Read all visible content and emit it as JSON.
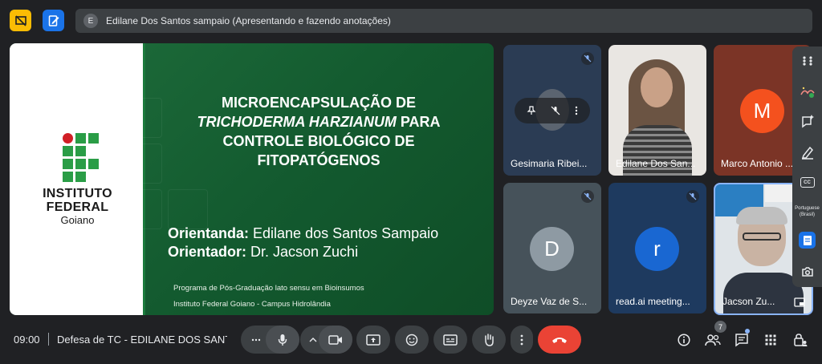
{
  "presenter": {
    "avatar_letter": "E",
    "text": "Edilane Dos Santos sampaio (Apresentando e fazendo anotações)"
  },
  "slide": {
    "institution_line1": "INSTITUTO",
    "institution_line2": "FEDERAL",
    "institution_line3": "Goiano",
    "title_line1": "MICROENCAPSULAÇÃO DE",
    "title_line2_italic": "TRICHODERMA HARZIANUM",
    "title_line2_rest": " PARA",
    "title_line3": "CONTROLE BIOLÓGICO DE",
    "title_line4": "FITOPATÓGENOS",
    "orientanda_label": "Orientanda:",
    "orientanda_name": " Edilane dos Santos Sampaio",
    "orientador_label": "Orientador:",
    "orientador_name": " Dr. Jacson Zuchi",
    "program_line1": "Programa de Pós-Graduação lato sensu em Bioinsumos",
    "program_line2": "Instituto Federal Goiano - Campus Hidrolândia"
  },
  "participants": [
    {
      "name": "Gesimaria Ribei...",
      "muted": true
    },
    {
      "name": "Edilane Dos San...",
      "muted": false
    },
    {
      "name": "Marco Antonio ...",
      "avatar_letter": "M",
      "avatar_color": "#f4511e",
      "muted": false
    },
    {
      "name": "Deyze Vaz de S...",
      "avatar_letter": "D",
      "avatar_color": "#8e9aa3",
      "muted": true
    },
    {
      "name": "read.ai meeting...",
      "avatar_letter": "r",
      "avatar_color": "#1967d2",
      "muted": true
    },
    {
      "name": "Jacson Zu...",
      "muted": false
    }
  ],
  "side_panel": {
    "cc_label": "CC",
    "language_line1": "Portuguese",
    "language_line2": "(Brasil)"
  },
  "bottom": {
    "time": "09:00",
    "meeting_title": "Defesa de TC - EDILANE DOS SANTOS SAMPAIO",
    "people_count": "7"
  },
  "colors": {
    "background": "#202124",
    "control": "#3c4043",
    "end_call": "#ea4335",
    "accent": "#1a73e8"
  }
}
